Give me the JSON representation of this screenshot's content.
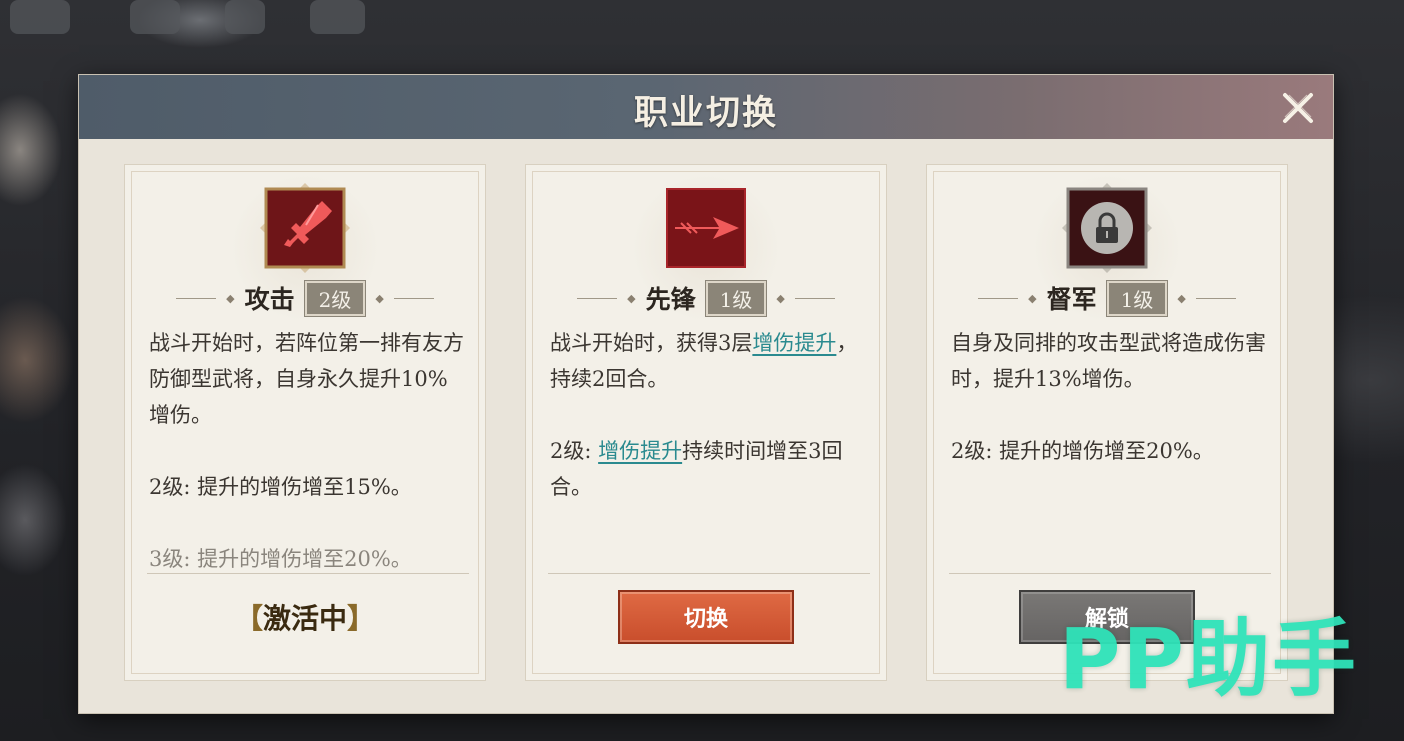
{
  "dialog": {
    "title": "职业切换",
    "close_icon": "close-icon"
  },
  "cards": [
    {
      "icon": "sword-icon",
      "name": "攻击",
      "level": "2级",
      "desc": [
        "战斗开始时，若阵位第一排有友方防御型武将，自身永久提升10%增伤。"
      ],
      "level2": "2级: 提升的增伤增至15%。",
      "level3": "3级: 提升的增伤增至20%。",
      "status": "激活中"
    },
    {
      "icon": "spear-icon",
      "name": "先锋",
      "level": "1级",
      "desc_pre": "战斗开始时，获得3层",
      "desc_link": "增伤提升",
      "desc_post": "，持续2回合。",
      "level2_pre": "2级: ",
      "level2_link": "增伤提升",
      "level2_post": "持续时间增至3回合。",
      "button": "切换"
    },
    {
      "icon": "lock-icon",
      "name": "督军",
      "level": "1级",
      "desc": "自身及同排的攻击型武将造成伤害时，提升13%增伤。",
      "level2": "2级: 提升的增伤增至20%。",
      "button": "解锁"
    }
  ],
  "watermark": "PP助手",
  "colors": {
    "switch_button": "#d45a36",
    "unlock_button": "#716f6d",
    "link": "#2a8a8f",
    "watermark": "#2fe3b9"
  }
}
